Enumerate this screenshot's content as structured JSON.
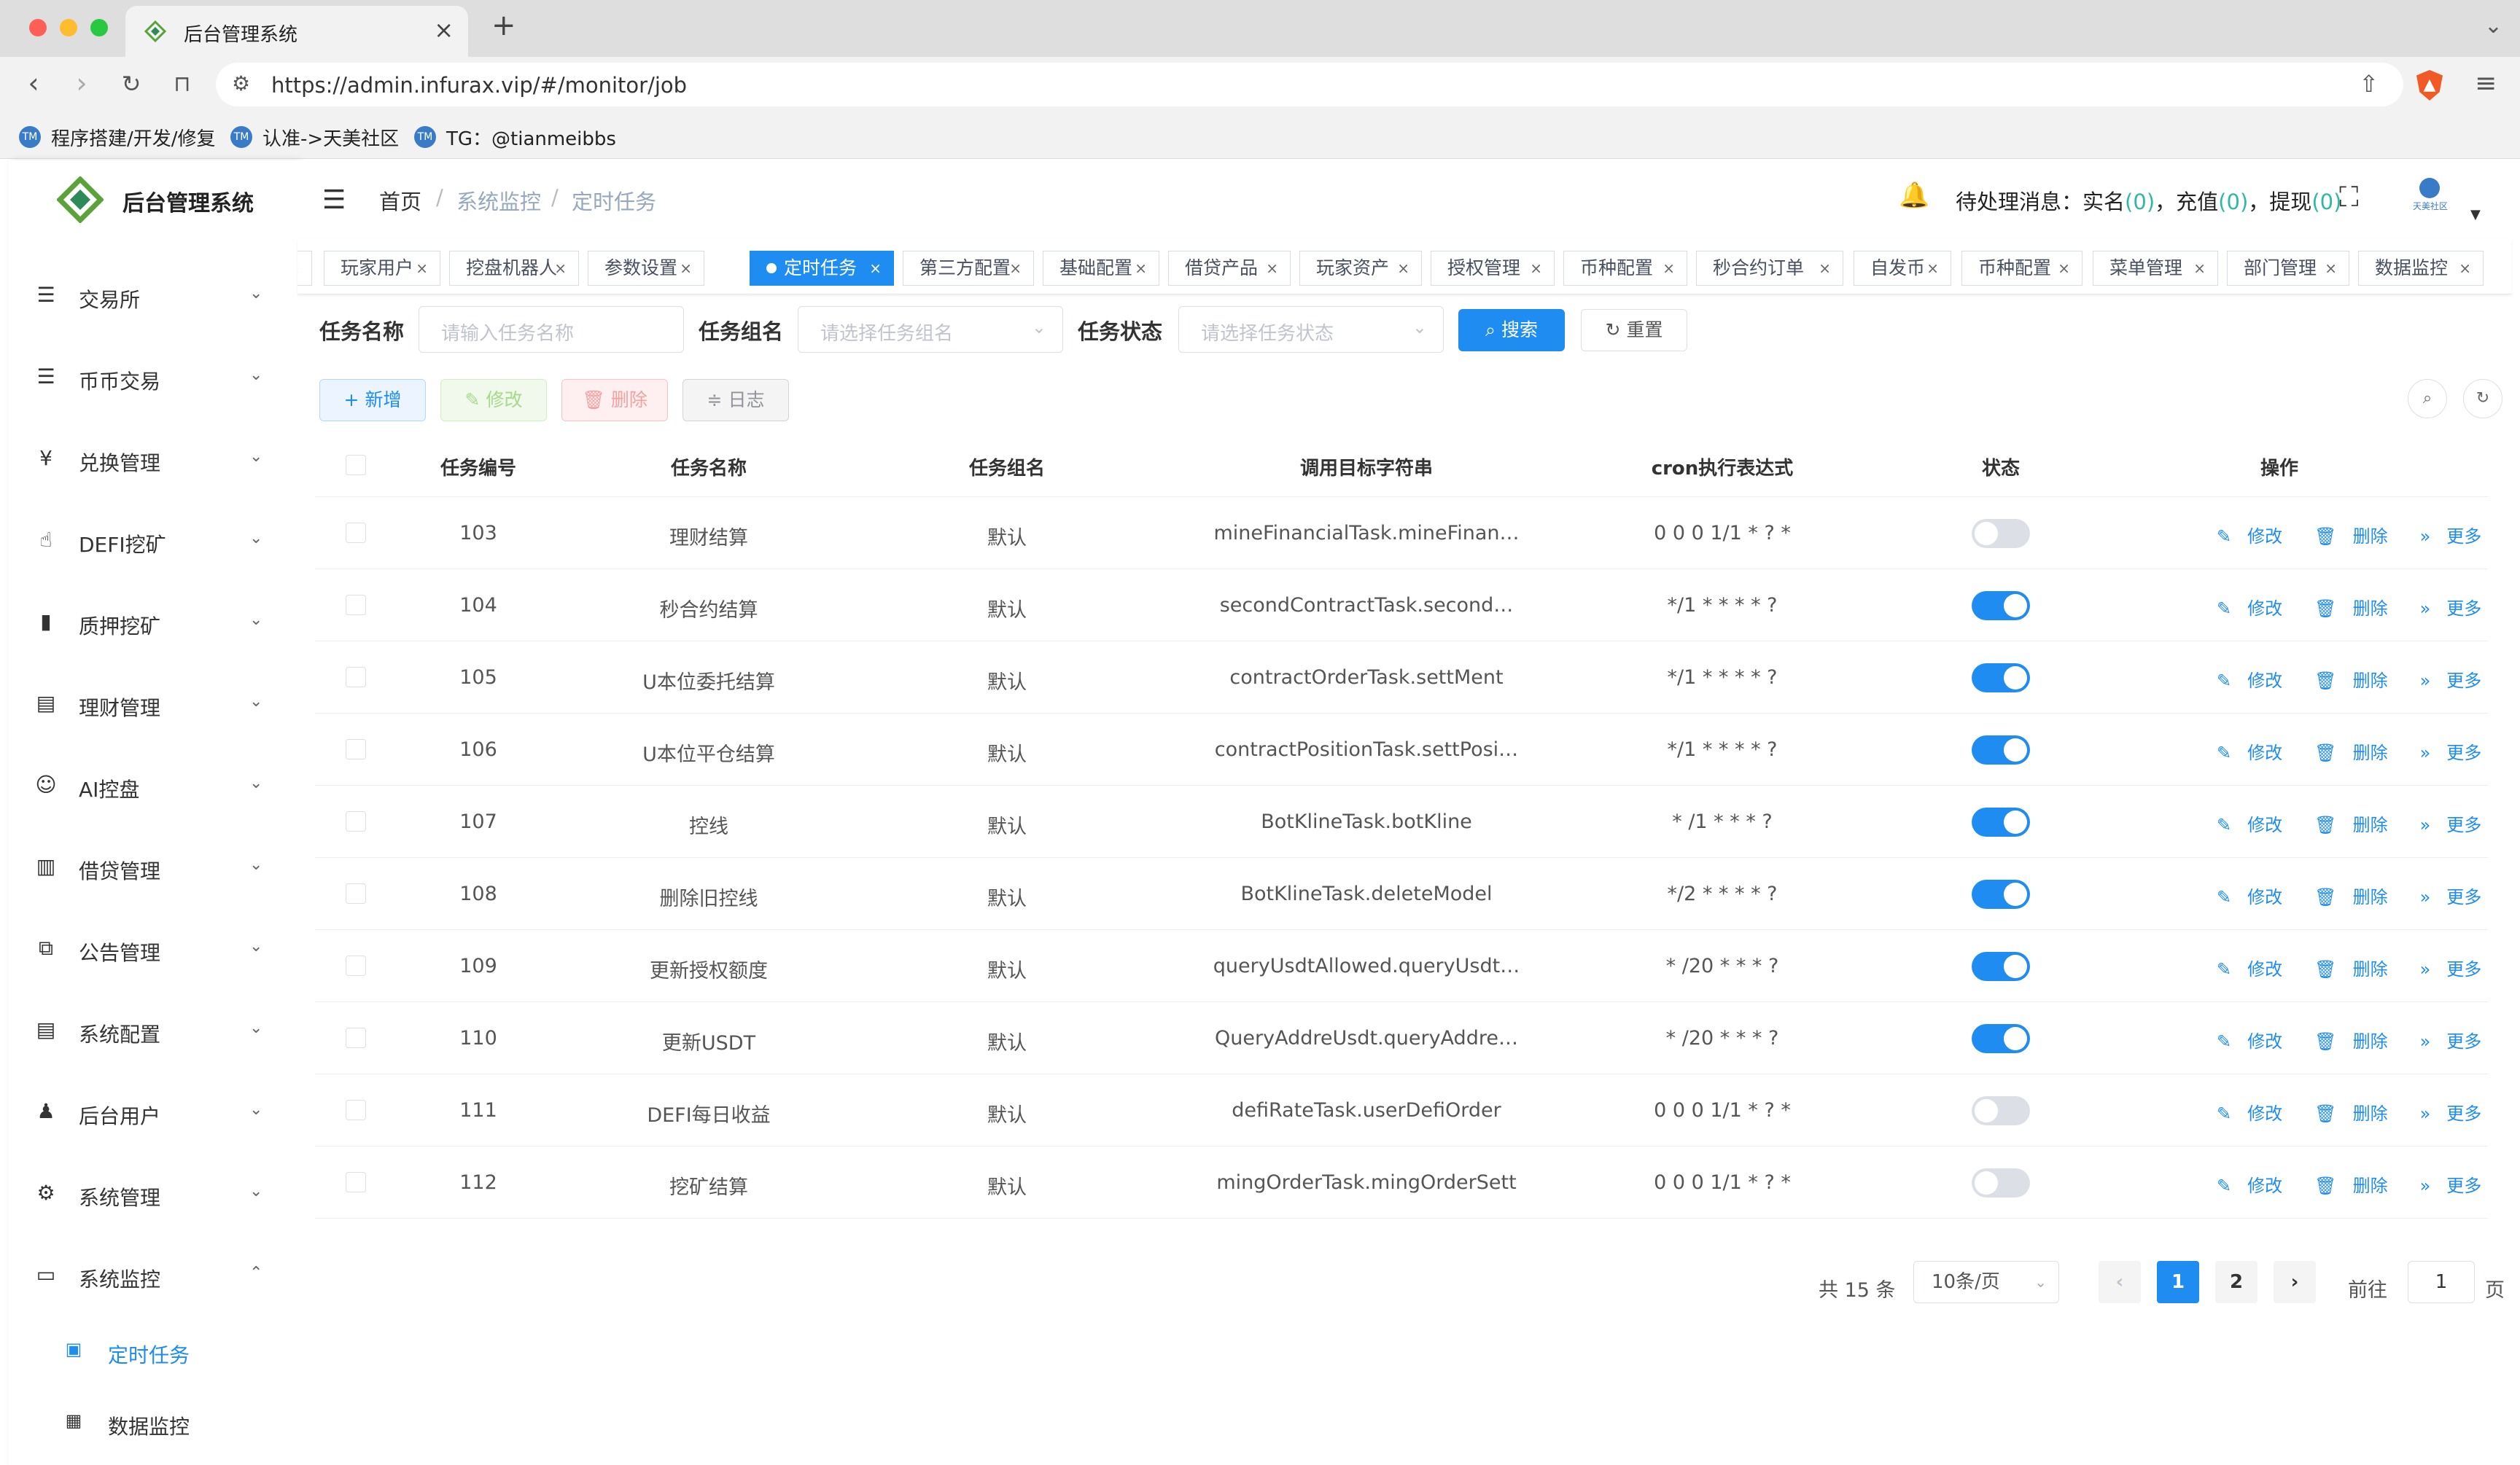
{
  "browser": {
    "tab_title": "后台管理系统",
    "url": "https://admin.infurax.vip/#/monitor/job",
    "bookmarks": [
      {
        "label": "程序搭建/开发/修复"
      },
      {
        "label": "认准->天美社区"
      },
      {
        "label": "TG：@tianmeibbs"
      }
    ]
  },
  "sidebar": {
    "app_title": "后台管理系统",
    "menu": [
      {
        "label": "交易所",
        "icon": "list-icon"
      },
      {
        "label": "币币交易",
        "icon": "list-icon"
      },
      {
        "label": "兑换管理",
        "icon": "yen-icon"
      },
      {
        "label": "DEFI挖矿",
        "icon": "hand-icon"
      },
      {
        "label": "质押挖矿",
        "icon": "bar-chart-icon"
      },
      {
        "label": "理财管理",
        "icon": "document-icon"
      },
      {
        "label": "AI控盘",
        "icon": "robot-icon"
      },
      {
        "label": "借贷管理",
        "icon": "book-icon"
      },
      {
        "label": "公告管理",
        "icon": "open-book-icon"
      },
      {
        "label": "系统配置",
        "icon": "document-icon"
      },
      {
        "label": "后台用户",
        "icon": "user-icon"
      },
      {
        "label": "系统管理",
        "icon": "gear-icon"
      },
      {
        "label": "系统监控",
        "icon": "monitor-icon"
      }
    ],
    "submenu": [
      {
        "label": "定时任务",
        "icon": "job-icon",
        "active": true
      },
      {
        "label": "数据监控",
        "icon": "chart-icon",
        "active": false
      }
    ]
  },
  "header": {
    "breadcrumb": [
      "首页",
      "系统监控",
      "定时任务"
    ],
    "notice_label": "待处理消息：",
    "notice_items": [
      {
        "label": "实名",
        "count": "0"
      },
      {
        "label": "充值",
        "count": "0"
      },
      {
        "label": "提现",
        "count": "0"
      }
    ],
    "avatar_text": "天美社区"
  },
  "tags": [
    "玩家用户",
    "挖盘机器人",
    "参数设置",
    "定时任务",
    "第三方配置",
    "基础配置",
    "借贷产品",
    "玩家资产",
    "授权管理",
    "币种配置",
    "秒合约订单",
    "自发币",
    "币种配置",
    "菜单管理",
    "部门管理",
    "数据监控"
  ],
  "active_tag": "定时任务",
  "filters": {
    "job_name_label": "任务名称",
    "job_name_placeholder": "请输入任务名称",
    "job_group_label": "任务组名",
    "job_group_placeholder": "请选择任务组名",
    "job_status_label": "任务状态",
    "job_status_placeholder": "请选择任务状态",
    "search_label": "搜索",
    "reset_label": "重置"
  },
  "actions": {
    "add": "新增",
    "edit": "修改",
    "delete": "删除",
    "log": "日志"
  },
  "table": {
    "columns": [
      "任务编号",
      "任务名称",
      "任务组名",
      "调用目标字符串",
      "cron执行表达式",
      "状态",
      "操作"
    ],
    "rows": [
      {
        "id": "103",
        "name": "理财结算",
        "group": "默认",
        "target": "mineFinancialTask.mineFinan…",
        "cron": "0 0 0 1/1 * ? *",
        "enabled": false
      },
      {
        "id": "104",
        "name": "秒合约结算",
        "group": "默认",
        "target": "secondContractTask.second…",
        "cron": "*/1 * * * * ?",
        "enabled": true
      },
      {
        "id": "105",
        "name": "U本位委托结算",
        "group": "默认",
        "target": "contractOrderTask.settMent",
        "cron": "*/1 * * * * ?",
        "enabled": true
      },
      {
        "id": "106",
        "name": "U本位平仓结算",
        "group": "默认",
        "target": "contractPositionTask.settPosi…",
        "cron": "*/1 * * * * ?",
        "enabled": true
      },
      {
        "id": "107",
        "name": "控线",
        "group": "默认",
        "target": "BotKlineTask.botKline",
        "cron": "* /1 * * * ?",
        "enabled": true
      },
      {
        "id": "108",
        "name": "删除旧控线",
        "group": "默认",
        "target": "BotKlineTask.deleteModel",
        "cron": "*/2 * * * * ?",
        "enabled": true
      },
      {
        "id": "109",
        "name": "更新授权额度",
        "group": "默认",
        "target": "queryUsdtAllowed.queryUsdt…",
        "cron": "* /20 * * * ?",
        "enabled": true
      },
      {
        "id": "110",
        "name": "更新USDT",
        "group": "默认",
        "target": "QueryAddreUsdt.queryAddre…",
        "cron": "* /20 * * * ?",
        "enabled": true
      },
      {
        "id": "111",
        "name": "DEFI每日收益",
        "group": "默认",
        "target": "defiRateTask.userDefiOrder",
        "cron": "0 0 0 1/1 * ? *",
        "enabled": false
      },
      {
        "id": "112",
        "name": "挖矿结算",
        "group": "默认",
        "target": "mingOrderTask.mingOrderSett",
        "cron": "0 0 0 1/1 * ? *",
        "enabled": false
      }
    ],
    "row_ops": {
      "edit": "修改",
      "delete": "删除",
      "more": "更多"
    }
  },
  "pagination": {
    "total_text": "共 15 条",
    "page_size": "10条/页",
    "pages": [
      "1",
      "2"
    ],
    "current": "1",
    "goto_label": "前往",
    "goto_value": "1",
    "page_suffix": "页"
  },
  "colors": {
    "primary": "#1e8cf0",
    "notice_count": "#2fb8a6"
  }
}
